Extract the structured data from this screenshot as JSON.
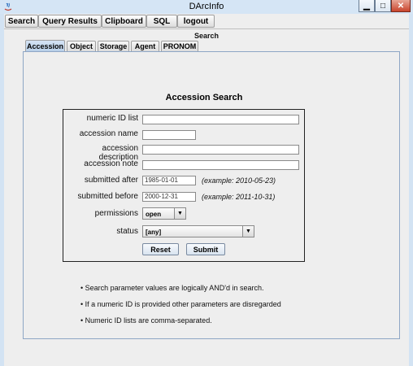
{
  "window": {
    "title": "DArcInfo",
    "minimize_glyph": "▁",
    "maximize_glyph": "□",
    "close_glyph": "✕"
  },
  "menu": [
    "Search",
    "Query Results",
    "Clipboard",
    "SQL",
    "logout"
  ],
  "section_title": "Search",
  "tabs": [
    "Accession",
    "Object",
    "Storage",
    "Agent",
    "PRONOM"
  ],
  "form": {
    "title": "Accession Search",
    "fields": {
      "numeric_id_list": {
        "label": "numeric ID list",
        "value": ""
      },
      "accession_name": {
        "label": "accession name",
        "value": ""
      },
      "accession_description": {
        "label": "accession description",
        "value": ""
      },
      "accession_note": {
        "label": "accession note",
        "value": ""
      },
      "submitted_after": {
        "label": "submitted after",
        "value": "1985-01-01",
        "example": "(example: 2010-05-23)"
      },
      "submitted_before": {
        "label": "submitted before",
        "value": "2000-12-31",
        "example": "(example: 2011-10-31)"
      },
      "permissions": {
        "label": "permissions",
        "value": "open"
      },
      "status": {
        "label": "status",
        "value": "[any]"
      }
    },
    "reset_label": "Reset",
    "submit_label": "Submit"
  },
  "notes": [
    "• Search parameter values are logically AND'd in search.",
    "• If a numeric ID is provided other parameters are disregarded",
    "• Numeric ID lists are comma-separated."
  ],
  "colors": {
    "accent": "#b8cfe8",
    "titlebar": "#d5e5f5",
    "close": "#c9442c"
  }
}
